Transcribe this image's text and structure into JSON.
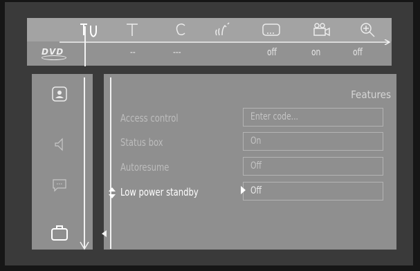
{
  "top_icons": [
    {
      "name": "setup-icon",
      "selected": true
    },
    {
      "name": "title-icon"
    },
    {
      "name": "chapter-icon"
    },
    {
      "name": "audio-icon"
    },
    {
      "name": "subtitle-icon"
    },
    {
      "name": "camera-angle-icon"
    },
    {
      "name": "zoom-icon"
    }
  ],
  "value_bar": {
    "logo": "DVD",
    "values": [
      "--",
      "---",
      "off",
      "on",
      "off"
    ]
  },
  "sidebar": {
    "items": [
      {
        "name": "picture-icon"
      },
      {
        "name": "sound-icon"
      },
      {
        "name": "language-icon"
      },
      {
        "name": "features-icon",
        "selected": true
      }
    ]
  },
  "panel": {
    "title": "Features",
    "rows": [
      {
        "label": "Access control",
        "value": "Enter code..."
      },
      {
        "label": "Status box",
        "value": "On"
      },
      {
        "label": "Autoresume",
        "value": "Off"
      },
      {
        "label": "Low power standby",
        "value": "Off",
        "active": true
      }
    ]
  },
  "colors": {
    "background": "#3a3a3a",
    "bar": "#a3a3a3",
    "panel": "#8f8f8f",
    "line": "#f2f2f2"
  }
}
